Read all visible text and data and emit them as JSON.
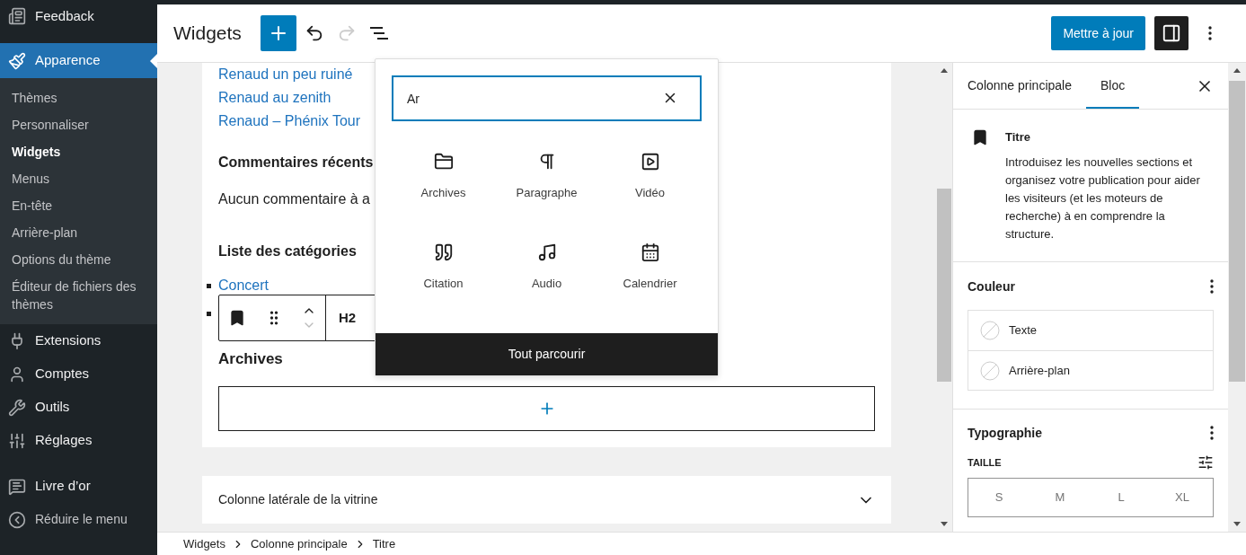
{
  "admin_menu": {
    "groups": [
      [
        {
          "label": "Feedback",
          "selected": false
        }
      ],
      [
        {
          "label": "Apparence",
          "selected": true,
          "children": [
            {
              "label": "Thèmes",
              "selected": false
            },
            {
              "label": "Personnaliser",
              "selected": false
            },
            {
              "label": "Widgets",
              "selected": true
            },
            {
              "label": "Menus",
              "selected": false
            },
            {
              "label": "En-tête",
              "selected": false
            },
            {
              "label": "Arrière-plan",
              "selected": false
            },
            {
              "label": "Options du thème",
              "selected": false
            },
            {
              "label": "Éditeur de fichiers des thèmes",
              "selected": false
            }
          ]
        },
        {
          "label": "Extensions",
          "selected": false
        },
        {
          "label": "Comptes",
          "selected": false
        },
        {
          "label": "Outils",
          "selected": false
        },
        {
          "label": "Réglages",
          "selected": false
        }
      ],
      [
        {
          "label": "Livre d’or",
          "selected": false
        }
      ]
    ],
    "collapse": "Réduire le menu"
  },
  "header": {
    "title": "Widgets",
    "undo_disabled": false,
    "redo_disabled": true,
    "update_button": "Mettre à jour",
    "settings_toggle_on": true
  },
  "widget_area": {
    "links": [
      "Renaud  un peu ruiné",
      "Renaud au zenith",
      "Renaud – Phénix Tour"
    ],
    "sections": [
      {
        "kind": "heading",
        "text": "Commentaires récents"
      },
      {
        "kind": "paragraph",
        "text": "Aucun commentaire à a"
      },
      {
        "kind": "heading",
        "text": "Liste des catégories"
      },
      {
        "kind": "list_item",
        "text": "Concert"
      }
    ],
    "block_toolbar": {
      "level": "H2"
    },
    "selected_heading": "Archives"
  },
  "collapsed_area": {
    "title": "Colonne latérale de la vitrine",
    "expanded": false
  },
  "inserter": {
    "search_value": "Ar",
    "results": [
      "Archives",
      "Paragraphe",
      "Vidéo",
      "Citation",
      "Audio",
      "Calendrier"
    ],
    "browse_all": "Tout parcourir"
  },
  "settings_panel": {
    "tabs": [
      {
        "label": "Colonne principale",
        "selected": false
      },
      {
        "label": "Bloc",
        "selected": true
      }
    ],
    "block_card": {
      "title": "Titre",
      "description": "Introduisez les nouvelles sections et organisez votre publication pour aider les visiteurs (et les moteurs de recherche) à en comprendre la structure."
    },
    "color": {
      "title": "Couleur",
      "items": [
        "Texte",
        "Arrière-plan"
      ]
    },
    "typography": {
      "title": "Typographie",
      "size_label": "TAILLE",
      "sizes": [
        {
          "label": "S",
          "selected": false
        },
        {
          "label": "M",
          "selected": false
        },
        {
          "label": "L",
          "selected": false
        },
        {
          "label": "XL",
          "selected": false
        }
      ]
    }
  },
  "breadcrumb": [
    "Widgets",
    "Colonne principale",
    "Titre"
  ]
}
